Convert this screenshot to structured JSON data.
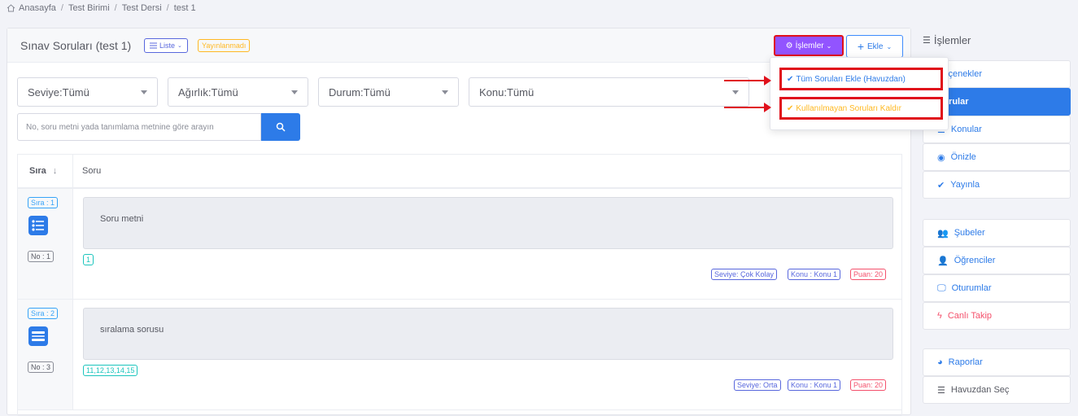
{
  "breadcrumb": {
    "items": [
      "Anasayfa",
      "Test Birimi",
      "Test Dersi",
      "test 1"
    ],
    "separator": "/"
  },
  "header": {
    "title": "Sınav Soruları (test 1)",
    "liste_label": "Liste",
    "status_badge": "Yayınlanmadı",
    "islemler_label": "İşlemler",
    "ekle_label": "Ekle"
  },
  "dropdown": {
    "items": [
      "Tüm Soruları Ekle (Havuzdan)",
      "Kullanılmayan Soruları Kaldır"
    ]
  },
  "filters": {
    "seviye": "Seviye:Tümü",
    "agirlik": "Ağırlık:Tümü",
    "durum": "Durum:Tümü",
    "konu": "Konu:Tümü"
  },
  "search": {
    "placeholder": "No, soru metni yada tanımlama metnine göre arayın"
  },
  "table": {
    "col_sira": "Sıra",
    "col_soru": "Soru",
    "rows": [
      {
        "sira": "Sıra : 1",
        "no": "No : 1",
        "text": "Soru metni",
        "answer": "1",
        "seviye": "Seviye: Çok Kolay",
        "konu": "Konu : Konu 1",
        "puan": "Puan: 20"
      },
      {
        "sira": "Sıra : 2",
        "no": "No : 3",
        "text": "sıralama sorusu",
        "answer": "11,12,13,14,15",
        "seviye": "Seviye: Orta",
        "konu": "Konu : Konu 1",
        "puan": "Puan: 20"
      }
    ]
  },
  "sidebar": {
    "title": "İşlemler",
    "items": [
      "Seçenekler",
      "Sorular",
      "Konular",
      "Önizle",
      "Yayınla"
    ],
    "items2": [
      "Şubeler",
      "Öğrenciler",
      "Oturumlar",
      "Canlı Takip"
    ],
    "items3": [
      "Raporlar",
      "Havuzdan Seç"
    ]
  },
  "colors": {
    "primary": "#2d7be8",
    "accent": "#9254ff",
    "highlight": "#e0101b",
    "warning": "#ffb822"
  }
}
